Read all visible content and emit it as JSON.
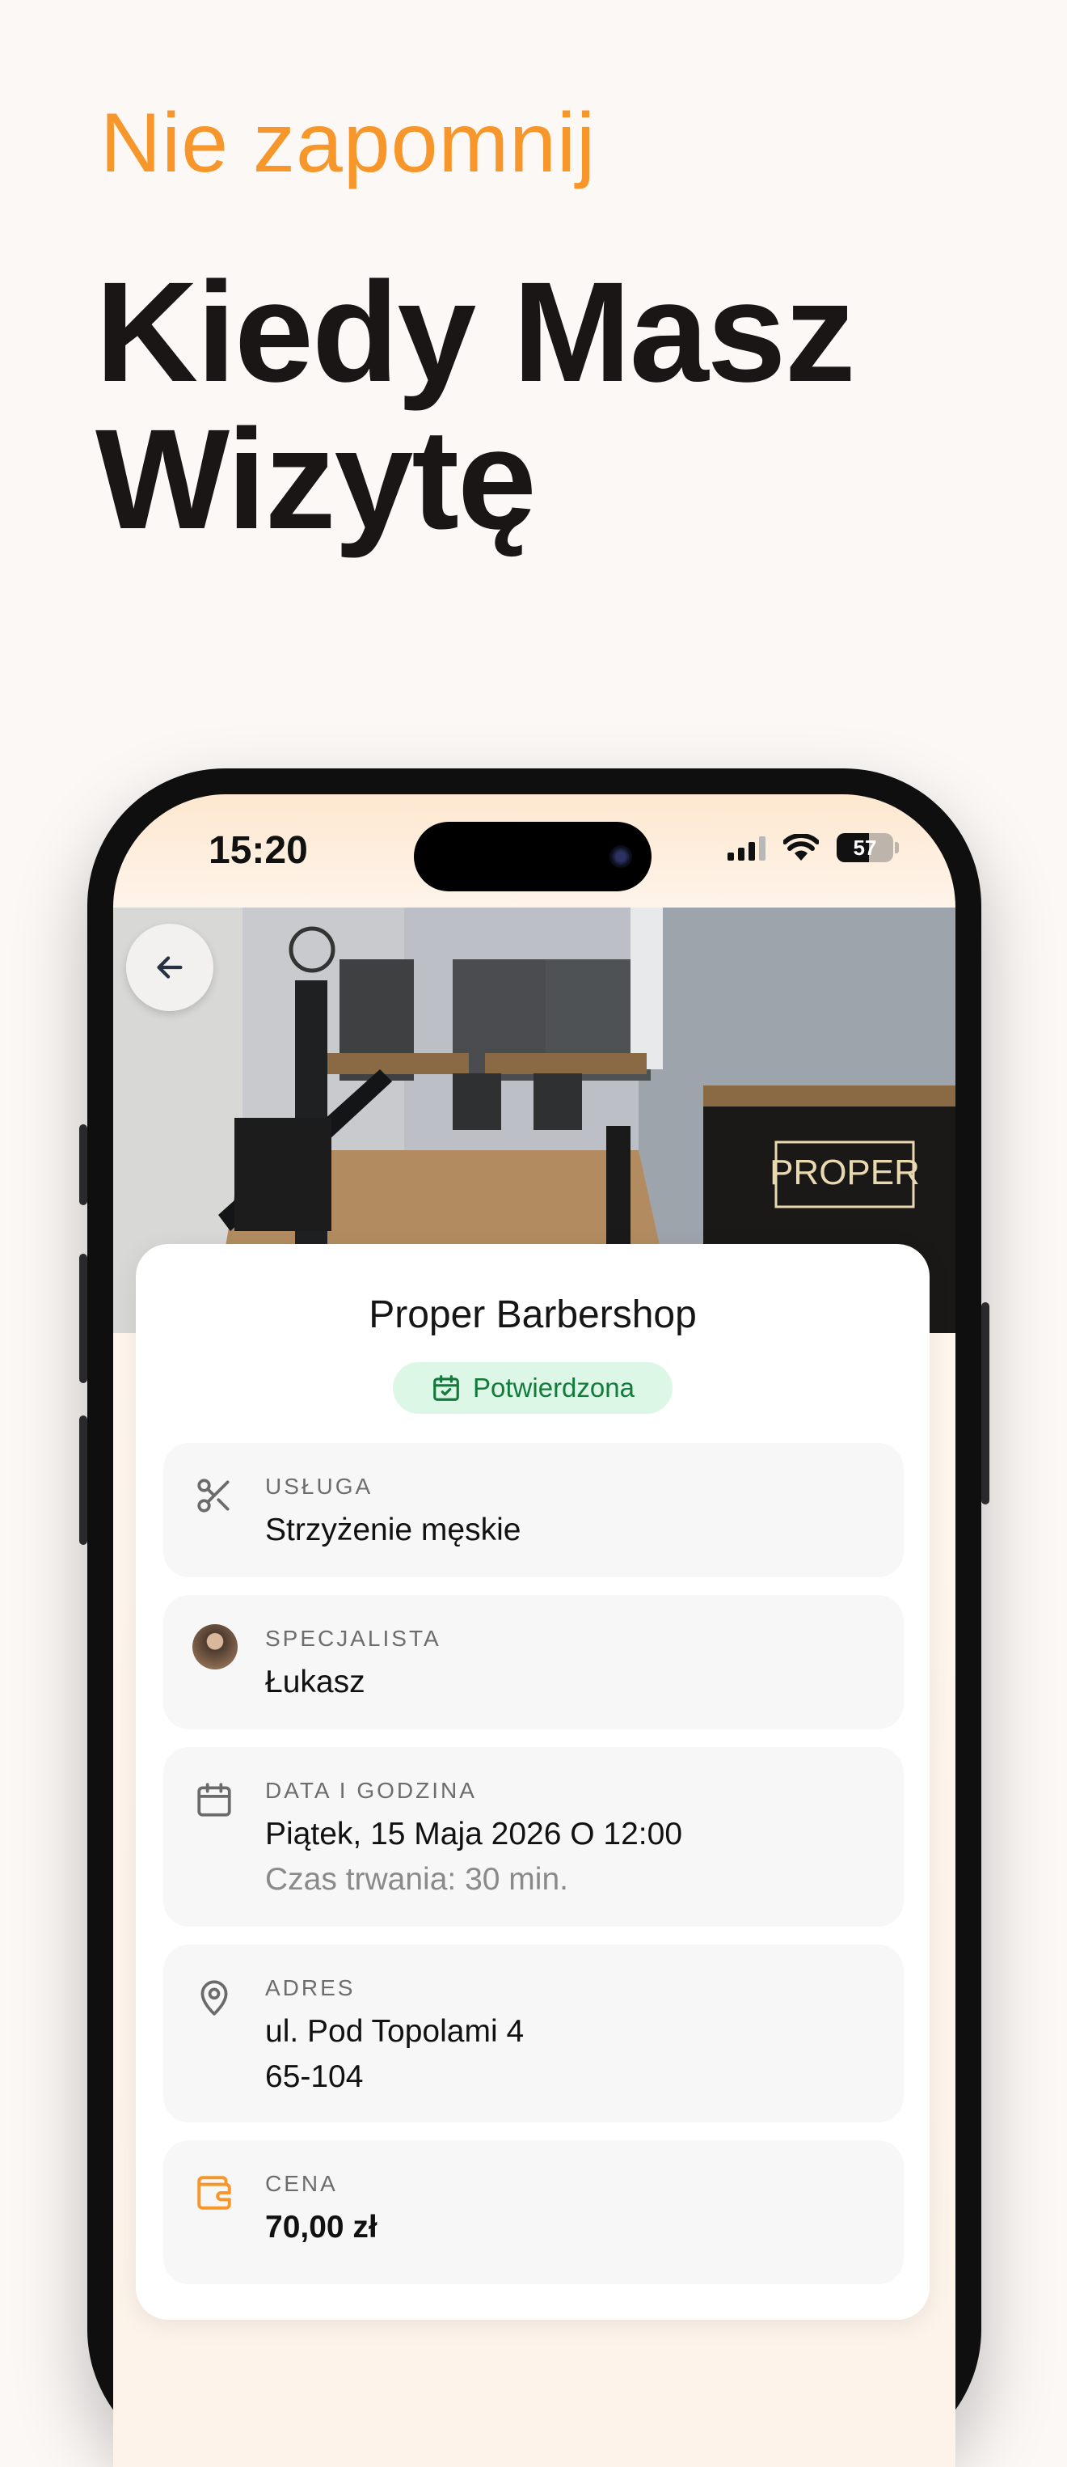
{
  "promo": {
    "kicker": "Nie zapomnij",
    "headline": "Kiedy Masz Wizytę"
  },
  "status_bar": {
    "time": "15:20",
    "battery": "57",
    "battery_level": 0.57
  },
  "booking": {
    "shop_name": "Proper Barbershop",
    "status": "Potwierdzona",
    "service": {
      "label": "USŁUGA",
      "value": "Strzyżenie męskie"
    },
    "specialist": {
      "label": "SPECJALISTA",
      "value": "Łukasz"
    },
    "datetime": {
      "label": "DATA I GODZINA",
      "value": "Piątek, 15 Maja 2026 O 12:00",
      "duration": "Czas trwania: 30 min."
    },
    "address": {
      "label": "ADRES",
      "line1": "ul. Pod Topolami 4",
      "line2": "65-104"
    },
    "price": {
      "label": "CENA",
      "value": "70,00 zł"
    }
  },
  "colors": {
    "accent": "#f7962a",
    "status_bg": "#dcf7e6",
    "status_text": "#127a3a"
  },
  "icons": [
    "back-arrow-icon",
    "scissors-icon",
    "calendar-icon",
    "map-pin-icon",
    "wallet-icon",
    "calendar-check-icon",
    "signal-icon",
    "wifi-icon",
    "battery-icon"
  ]
}
